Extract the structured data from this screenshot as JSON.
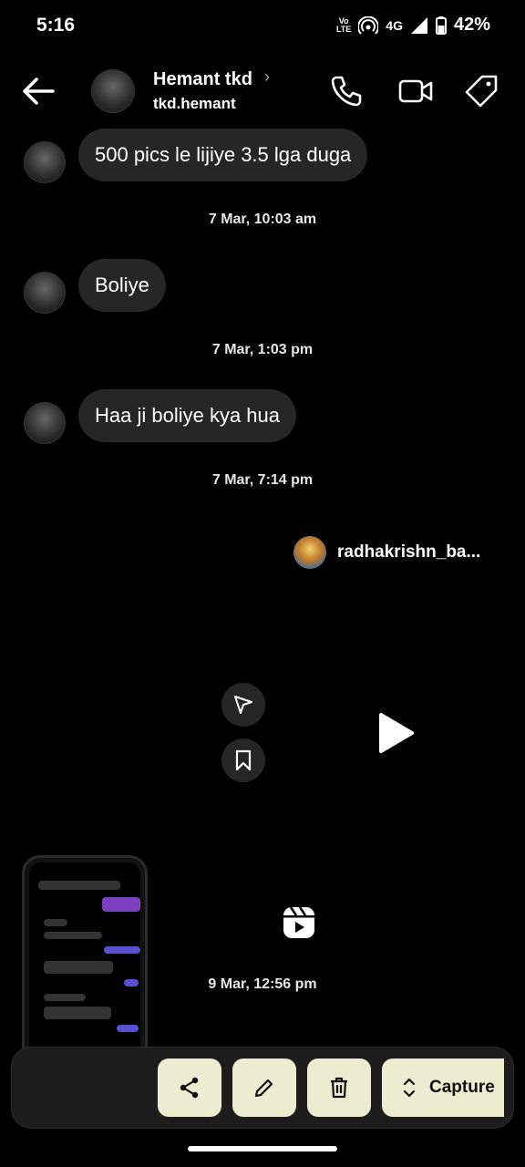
{
  "status_bar": {
    "time": "5:16",
    "volte_top": "Vo",
    "volte_bottom": "LTE",
    "network": "4G",
    "battery": "42%"
  },
  "header": {
    "name": "Hemant tkd",
    "chevron": "›",
    "username": "tkd.hemant"
  },
  "messages": [
    {
      "text": "500 pics le lijiye 3.5 lga duga"
    },
    {
      "text": "Boliye"
    },
    {
      "text": "Haa ji boliye kya hua"
    }
  ],
  "timestamps": [
    "7 Mar, 10:03 am",
    "7 Mar, 1:03 pm",
    "7 Mar, 7:14 pm",
    "9 Mar, 12:56 pm"
  ],
  "reel": {
    "owner": "radhakrishn_ba..."
  },
  "toolbar": {
    "capture_label": "Capture"
  },
  "icons": {
    "back": "back-arrow-icon",
    "call": "phone-icon",
    "video": "video-camera-icon",
    "tag": "tag-icon",
    "send": "send-icon",
    "save": "bookmark-icon",
    "play": "play-icon",
    "reels": "reels-icon",
    "share": "share-icon",
    "edit": "pencil-icon",
    "delete": "trash-icon",
    "expand": "expand-vertical-icon"
  },
  "colors": {
    "background": "#000000",
    "bubble": "#262626",
    "toolbar_button": "#ececd0"
  }
}
